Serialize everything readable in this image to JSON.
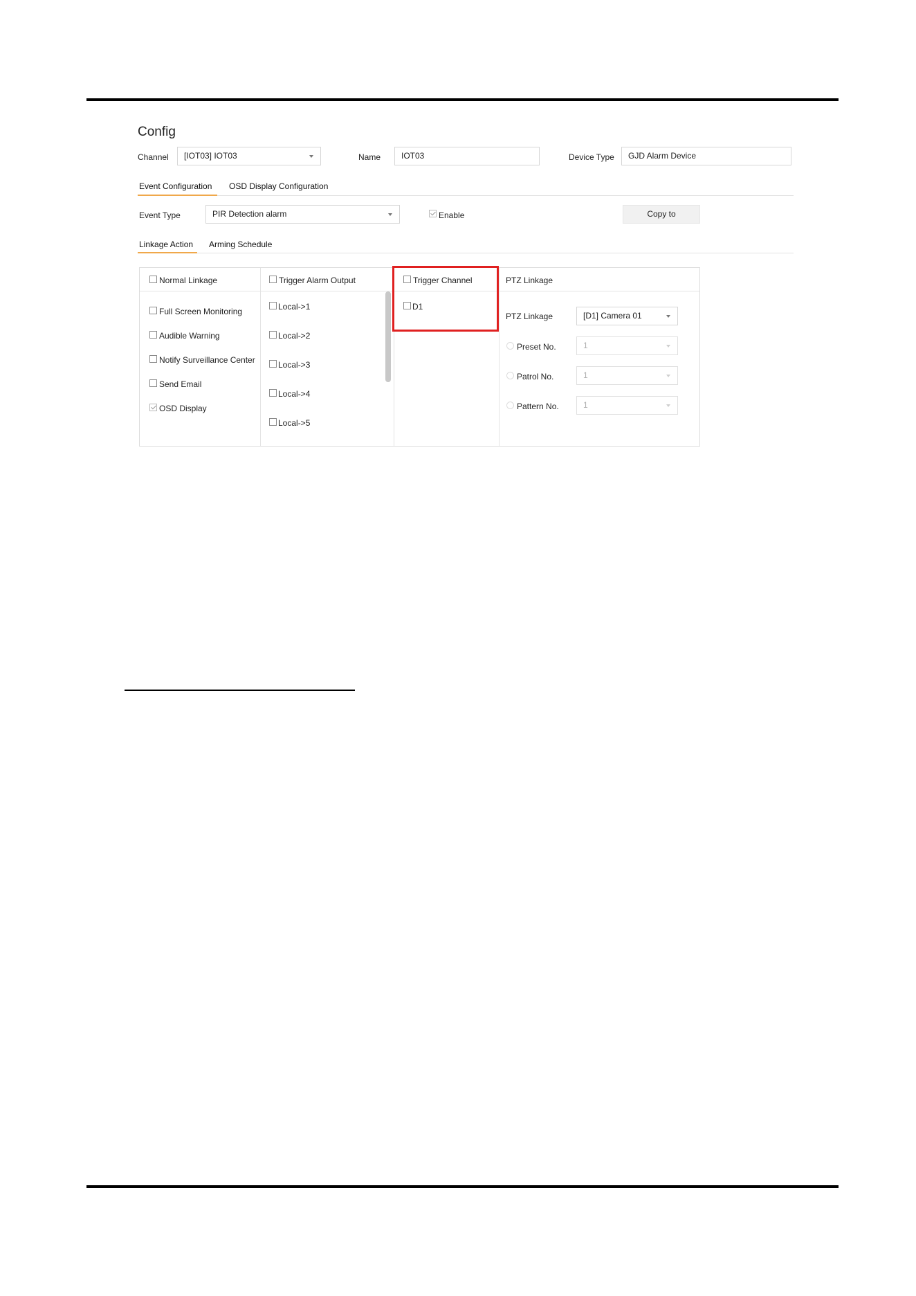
{
  "page": {
    "title": "Config"
  },
  "header": {
    "channel_label": "Channel",
    "channel_value": "[IOT03] IOT03",
    "name_label": "Name",
    "name_value": "IOT03",
    "device_type_label": "Device Type",
    "device_type_value": "GJD Alarm Device"
  },
  "tabs_top": [
    {
      "label": "Event Configuration",
      "active": true
    },
    {
      "label": "OSD Display Configuration",
      "active": false
    }
  ],
  "event": {
    "type_label": "Event Type",
    "type_value": "PIR Detection alarm",
    "enable_label": "Enable",
    "enable_checked": true,
    "copy_button": "Copy to"
  },
  "tabs_sub": [
    {
      "label": "Linkage Action",
      "active": true
    },
    {
      "label": "Arming Schedule",
      "active": false
    }
  ],
  "normal_linkage": {
    "header": "Normal Linkage",
    "items": [
      {
        "label": "Full Screen Monitoring",
        "checked": false
      },
      {
        "label": "Audible Warning",
        "checked": false
      },
      {
        "label": "Notify Surveillance Center",
        "checked": false
      },
      {
        "label": "Send Email",
        "checked": false
      },
      {
        "label": "OSD Display",
        "checked": true
      }
    ]
  },
  "trigger_alarm_output": {
    "header": "Trigger Alarm Output",
    "items": [
      "Local->1",
      "Local->2",
      "Local->3",
      "Local->4",
      "Local->5"
    ]
  },
  "trigger_channel": {
    "header": "Trigger Channel",
    "items": [
      "D1"
    ]
  },
  "ptz": {
    "header": "PTZ Linkage",
    "linkage_label": "PTZ Linkage",
    "linkage_value": "[D1] Camera 01",
    "preset_label": "Preset No.",
    "preset_value": "1",
    "patrol_label": "Patrol No.",
    "patrol_value": "1",
    "pattern_label": "Pattern No.",
    "pattern_value": "1"
  },
  "colors": {
    "accent": "#f0a84a",
    "highlight": "#e02020"
  }
}
